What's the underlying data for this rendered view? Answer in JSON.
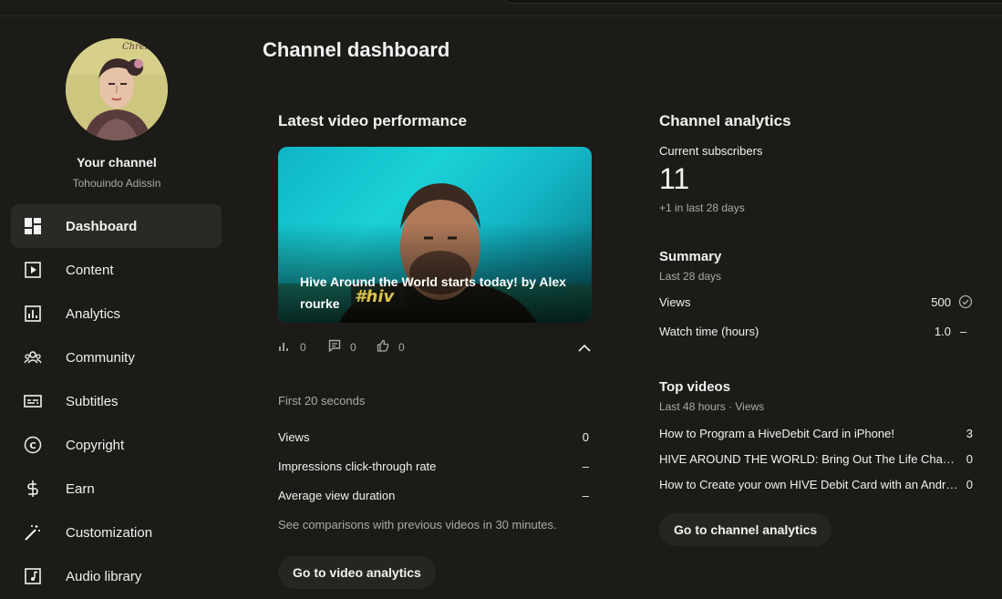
{
  "sidebar": {
    "your_channel": "Your channel",
    "channel_name": "Tohouindo Adissin",
    "avatar_signature": "Chrelena",
    "items": [
      {
        "label": "Dashboard",
        "icon": "dashboard-icon",
        "active": true
      },
      {
        "label": "Content",
        "icon": "content-icon"
      },
      {
        "label": "Analytics",
        "icon": "analytics-icon"
      },
      {
        "label": "Community",
        "icon": "community-icon"
      },
      {
        "label": "Subtitles",
        "icon": "subtitles-icon"
      },
      {
        "label": "Copyright",
        "icon": "copyright-icon"
      },
      {
        "label": "Earn",
        "icon": "earn-icon"
      },
      {
        "label": "Customization",
        "icon": "customization-icon"
      },
      {
        "label": "Audio library",
        "icon": "audio-library-icon"
      }
    ]
  },
  "page": {
    "title": "Channel dashboard"
  },
  "latest_video": {
    "heading": "Latest video performance",
    "video_title": "Hive Around the World starts today! by Alex rourke",
    "thumbnail_overlay": "#hiv",
    "stats": {
      "views": "0",
      "comments": "0",
      "likes": "0"
    },
    "period": "First 20 seconds",
    "rows": [
      {
        "label": "Views",
        "value": "0"
      },
      {
        "label": "Impressions click-through rate",
        "value": "–"
      },
      {
        "label": "Average view duration",
        "value": "–"
      }
    ],
    "comparison_note": "See comparisons with previous videos in 30 minutes.",
    "button": "Go to video analytics"
  },
  "channel_analytics": {
    "heading": "Channel analytics",
    "subs_label": "Current subscribers",
    "subs_value": "11",
    "subs_change": "+1 in last 28 days",
    "summary": {
      "heading": "Summary",
      "period": "Last 28 days",
      "rows": [
        {
          "label": "Views",
          "value": "500",
          "indicator": "check-circle-icon"
        },
        {
          "label": "Watch time (hours)",
          "value": "1.0",
          "indicator": "–"
        }
      ]
    },
    "top_videos": {
      "heading": "Top videos",
      "period": "Last 48 hours · Views",
      "rows": [
        {
          "label": "How to Program a HiveDebit Card in iPhone!",
          "value": "3"
        },
        {
          "label": "HIVE AROUND THE WORLD: Bring Out The Life Changing Power Of HIVE",
          "value": "0"
        },
        {
          "label": "How to Create your own HIVE Debit Card with an Android Phone",
          "value": "0"
        }
      ]
    },
    "button": "Go to channel analytics"
  },
  "colors": {
    "background": "#1c1b17",
    "active_nav": "#2a2925",
    "button_bg": "#262521",
    "text": "#f1f1f1",
    "muted": "#aaaaaa"
  }
}
